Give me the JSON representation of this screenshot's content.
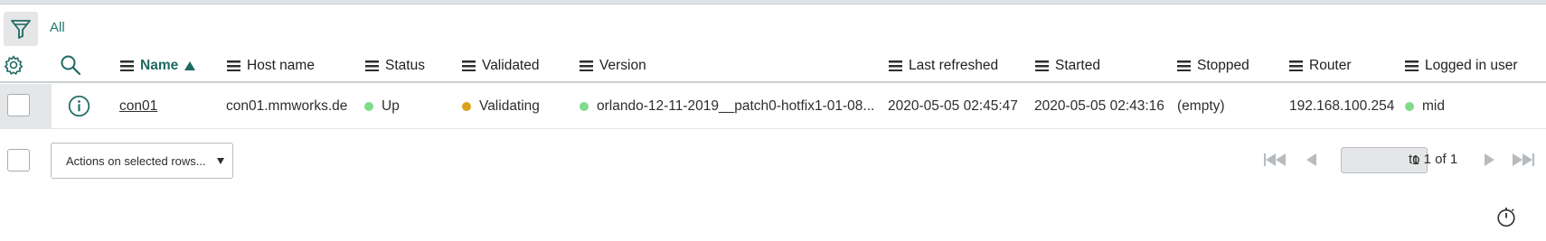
{
  "list": {
    "breadcrumb": "All",
    "columns": [
      {
        "label": "Name",
        "sorted": "asc"
      },
      {
        "label": "Host name"
      },
      {
        "label": "Status"
      },
      {
        "label": "Validated"
      },
      {
        "label": "Version"
      },
      {
        "label": "Last refreshed"
      },
      {
        "label": "Started"
      },
      {
        "label": "Stopped"
      },
      {
        "label": "Router"
      },
      {
        "label": "Logged in user"
      }
    ],
    "rows": [
      {
        "name": "con01",
        "host_name": "con01.mmworks.de",
        "status": "Up",
        "validated": "Validating",
        "version": "orlando-12-11-2019__patch0-hotfix1-01-08...",
        "last_refreshed": "2020-05-05 02:45:47",
        "started": "2020-05-05 02:43:16",
        "stopped": "(empty)",
        "router": "192.168.100.254",
        "logged_in_user": "mid"
      }
    ]
  },
  "footer": {
    "actions_select": "Actions on selected rows...",
    "page_number": "1",
    "page_range": "to 1 of 1"
  },
  "icons": {
    "filter": "filter-icon",
    "gear": "gear-icon",
    "search": "search-icon",
    "info": "info-icon",
    "timer": "stopwatch-icon"
  },
  "colors": {
    "accent": "#1f7a6f",
    "status_up": "#7fdc8a",
    "status_validating": "#d9a21b"
  }
}
